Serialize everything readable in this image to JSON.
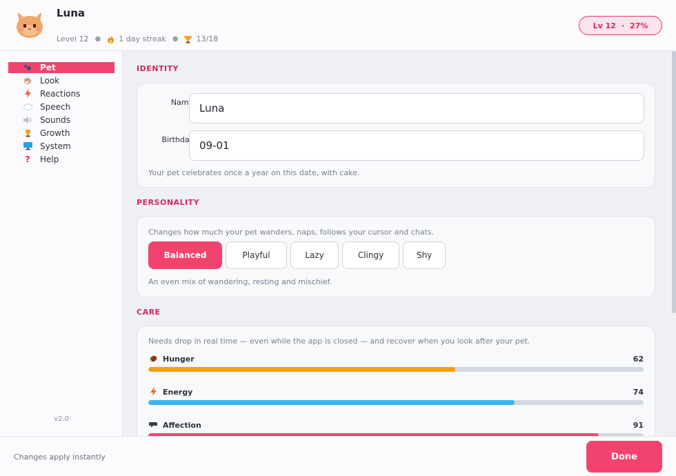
{
  "header": {
    "pet_name": "Luna",
    "level_text": "Level 12",
    "streak_text": "1 day streak",
    "trophies_text": "13/18",
    "level_pill": {
      "level": "Lv 12",
      "separator": "·",
      "progress": "27%"
    }
  },
  "sidebar": {
    "items": [
      {
        "label": "Pet",
        "icon": "paw-icon",
        "active": true
      },
      {
        "label": "Look",
        "icon": "palette-icon",
        "active": false
      },
      {
        "label": "Reactions",
        "icon": "lightning-icon",
        "active": false
      },
      {
        "label": "Speech",
        "icon": "speech-bubble-icon",
        "active": false
      },
      {
        "label": "Sounds",
        "icon": "speaker-icon",
        "active": false
      },
      {
        "label": "Growth",
        "icon": "trophy-icon",
        "active": false
      },
      {
        "label": "System",
        "icon": "monitor-icon",
        "active": false
      },
      {
        "label": "Help",
        "icon": "question-icon",
        "active": false
      }
    ],
    "version": "v2.0"
  },
  "identity": {
    "title": "IDENTITY",
    "name_label": "Name:",
    "name_value": "Luna",
    "birthday_label": "Birthday:",
    "birthday_value": "09-01",
    "helper": "Your pet celebrates once a year on this date, with cake."
  },
  "personality": {
    "title": "PERSONALITY",
    "description": "Changes how much your pet wanders, naps, follows your cursor and chats.",
    "options": [
      {
        "label": "Balanced",
        "active": true
      },
      {
        "label": "Playful",
        "active": false
      },
      {
        "label": "Lazy",
        "active": false
      },
      {
        "label": "Clingy",
        "active": false
      },
      {
        "label": "Shy",
        "active": false
      }
    ],
    "helper": "An even mix of wandering, resting and mischief."
  },
  "care": {
    "title": "CARE",
    "description": "Needs drop in real time — even while the app is closed — and recover when you look after your pet.",
    "needs": [
      {
        "name": "Hunger",
        "value": 62,
        "icon": "food-icon",
        "color": "#f5a10f"
      },
      {
        "name": "Energy",
        "value": 74,
        "icon": "lightning-icon",
        "color": "#35b6ef"
      },
      {
        "name": "Affection",
        "value": 91,
        "icon": "heart-icon",
        "color": "#f2436f"
      }
    ]
  },
  "footer": {
    "status": "Changes apply instantly",
    "done_label": "Done"
  },
  "colors": {
    "accent": "#f2436f",
    "section_title": "#d2275c"
  }
}
